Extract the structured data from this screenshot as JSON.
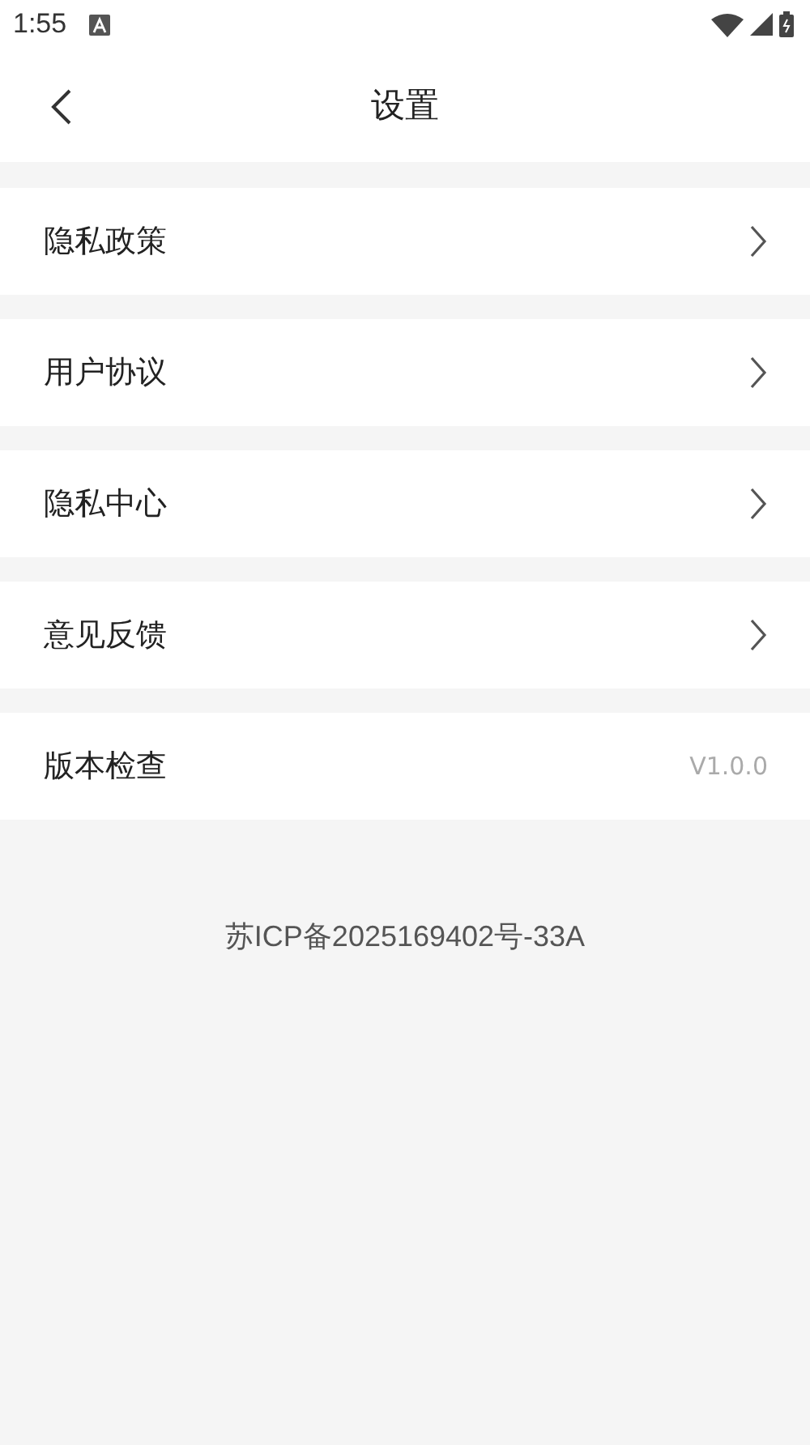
{
  "status_bar": {
    "time": "1:55"
  },
  "header": {
    "title": "设置"
  },
  "items": [
    {
      "kind": "link",
      "label": "隐私政策"
    },
    {
      "kind": "link",
      "label": "用户协议"
    },
    {
      "kind": "link",
      "label": "隐私中心"
    },
    {
      "kind": "link",
      "label": "意见反馈"
    },
    {
      "kind": "value",
      "label": "版本检查",
      "value": "V1.0.0"
    }
  ],
  "footer": {
    "text": "苏ICP备2025169402号-33A"
  }
}
